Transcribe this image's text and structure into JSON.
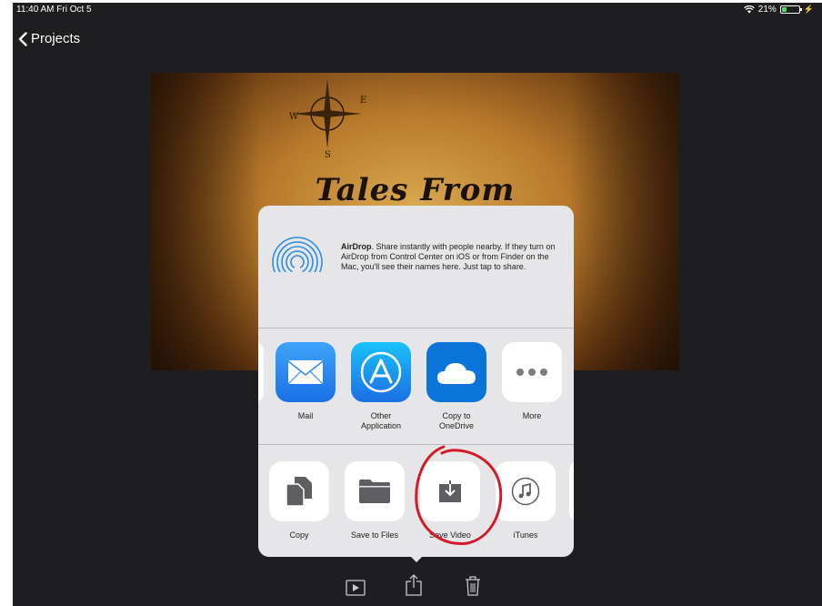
{
  "status_bar": {
    "time": "11:40 AM  Fri Oct 5",
    "battery": "21%"
  },
  "nav": {
    "back_label": "Projects"
  },
  "video": {
    "title": "Tales From"
  },
  "share_sheet": {
    "airdrop": {
      "title": "AirDrop",
      "description": ". Share instantly with people nearby. If they turn on AirDrop from Control Center on iOS or from Finder on the Mac, you'll see their names here. Just tap to share."
    },
    "apps": [
      {
        "label": "Mail",
        "icon": "mail-icon",
        "color": "#2f8ef1"
      },
      {
        "label": "Other Application",
        "icon": "app-store-icon",
        "color": "#1d8df0"
      },
      {
        "label": "Copy to OneDrive",
        "icon": "onedrive-icon",
        "color": "#0a74d8"
      },
      {
        "label": "More",
        "icon": "more-icon",
        "color": "#ffffff"
      }
    ],
    "actions": [
      {
        "label": "Copy",
        "icon": "copy-icon"
      },
      {
        "label": "Save to Files",
        "icon": "folder-icon"
      },
      {
        "label": "Save Video",
        "icon": "save-video-icon"
      },
      {
        "label": "iTunes",
        "icon": "music-note-icon"
      }
    ]
  },
  "annotation": {
    "color": "#d11b2a",
    "shape": "hand-drawn circle around Save Video"
  },
  "toolbar": {
    "icons": [
      "play-icon",
      "share-icon",
      "trash-icon"
    ]
  }
}
